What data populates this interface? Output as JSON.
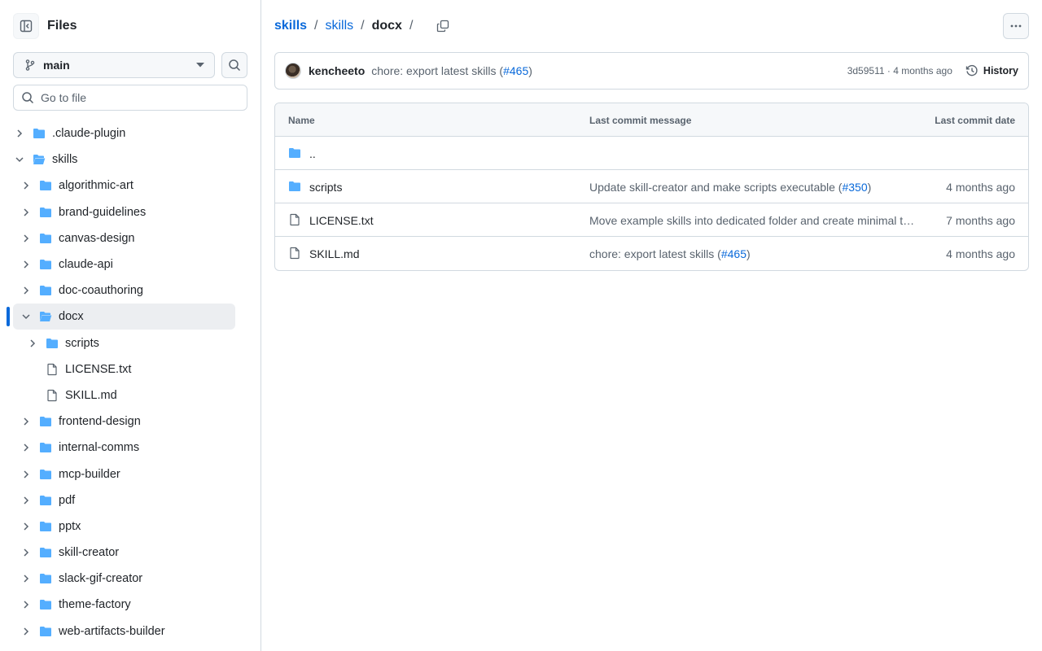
{
  "sidebar": {
    "title": "Files",
    "branch": "main",
    "goto_placeholder": "Go to file",
    "tree": [
      {
        "label": ".claude-plugin",
        "type": "folder",
        "depth": 0,
        "expanded": false
      },
      {
        "label": "skills",
        "type": "folder",
        "depth": 0,
        "expanded": true
      },
      {
        "label": "algorithmic-art",
        "type": "folder",
        "depth": 1,
        "expanded": false
      },
      {
        "label": "brand-guidelines",
        "type": "folder",
        "depth": 1,
        "expanded": false
      },
      {
        "label": "canvas-design",
        "type": "folder",
        "depth": 1,
        "expanded": false
      },
      {
        "label": "claude-api",
        "type": "folder",
        "depth": 1,
        "expanded": false
      },
      {
        "label": "doc-coauthoring",
        "type": "folder",
        "depth": 1,
        "expanded": false
      },
      {
        "label": "docx",
        "type": "folder",
        "depth": 1,
        "expanded": true,
        "active": true
      },
      {
        "label": "scripts",
        "type": "folder",
        "depth": 2,
        "expanded": false
      },
      {
        "label": "LICENSE.txt",
        "type": "file",
        "depth": 2
      },
      {
        "label": "SKILL.md",
        "type": "file",
        "depth": 2
      },
      {
        "label": "frontend-design",
        "type": "folder",
        "depth": 1,
        "expanded": false
      },
      {
        "label": "internal-comms",
        "type": "folder",
        "depth": 1,
        "expanded": false
      },
      {
        "label": "mcp-builder",
        "type": "folder",
        "depth": 1,
        "expanded": false
      },
      {
        "label": "pdf",
        "type": "folder",
        "depth": 1,
        "expanded": false
      },
      {
        "label": "pptx",
        "type": "folder",
        "depth": 1,
        "expanded": false
      },
      {
        "label": "skill-creator",
        "type": "folder",
        "depth": 1,
        "expanded": false
      },
      {
        "label": "slack-gif-creator",
        "type": "folder",
        "depth": 1,
        "expanded": false
      },
      {
        "label": "theme-factory",
        "type": "folder",
        "depth": 1,
        "expanded": false
      },
      {
        "label": "web-artifacts-builder",
        "type": "folder",
        "depth": 1,
        "expanded": false
      }
    ]
  },
  "breadcrumb": {
    "repo": "skills",
    "sep": "/",
    "folder": "skills",
    "current": "docx"
  },
  "commit": {
    "author": "kencheeto",
    "message": "chore: export latest skills (",
    "pr": "#465",
    "close": ")",
    "meta": "3d59511 · 4 months ago",
    "history_label": "History"
  },
  "files": {
    "headers": {
      "name": "Name",
      "message": "Last commit message",
      "date": "Last commit date"
    },
    "parent": "..",
    "rows": [
      {
        "name": "scripts",
        "type": "folder",
        "msg_pre": "Update skill-creator and make scripts executable (",
        "pr": "#350",
        "msg_post": ")",
        "date": "4 months ago"
      },
      {
        "name": "LICENSE.txt",
        "type": "file",
        "msg_pre": "Move example skills into dedicated folder and create minimal t…",
        "pr": "",
        "msg_post": "",
        "date": "7 months ago"
      },
      {
        "name": "SKILL.md",
        "type": "file",
        "msg_pre": "chore: export latest skills (",
        "pr": "#465",
        "msg_post": ")",
        "date": "4 months ago"
      }
    ]
  },
  "colors": {
    "link": "#0969da",
    "folder": "#54aeff",
    "muted": "#59636e"
  }
}
